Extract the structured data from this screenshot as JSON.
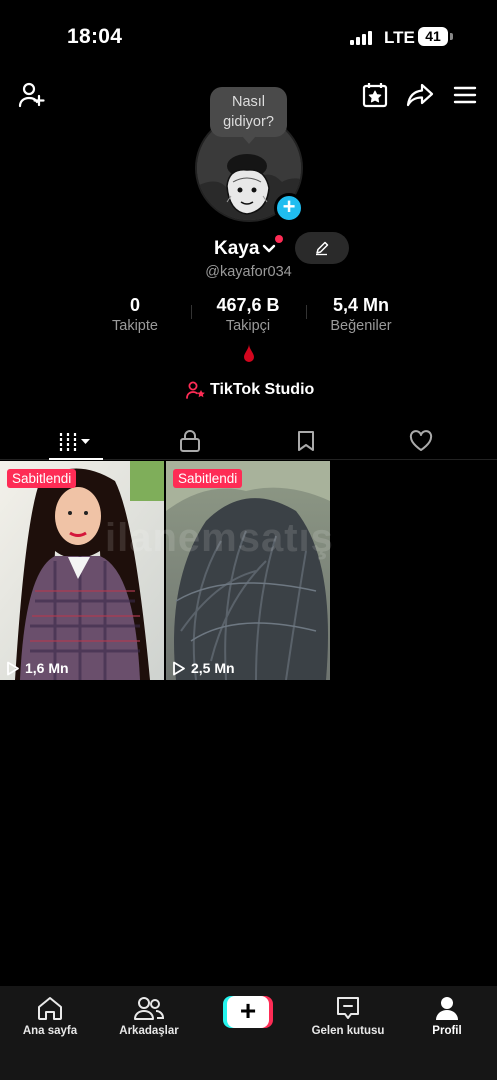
{
  "status_bar": {
    "time": "18:04",
    "network": "LTE",
    "battery": "41"
  },
  "header": {
    "left_icon": "add-friend-icon",
    "right_icons": [
      "calendar-star-icon",
      "share-icon",
      "menu-icon"
    ]
  },
  "profile": {
    "tooltip": "Nasıl gidiyor?",
    "display_name": "Kaya",
    "handle": "@kayafor034",
    "stats": [
      {
        "value": "0",
        "label": "Takipte"
      },
      {
        "value": "467,6 B",
        "label": "Takipçi"
      },
      {
        "value": "5,4 Mn",
        "label": "Beğeniler"
      }
    ],
    "studio_label": "TikTok Studio"
  },
  "tabs": [
    "videos-icon",
    "lock-icon",
    "bookmark-icon",
    "heart-icon"
  ],
  "videos": [
    {
      "badge": "Sabitlendi",
      "views": "1,6 Mn"
    },
    {
      "badge": "Sabitlendi",
      "views": "2,5 Mn"
    }
  ],
  "watermark": "ilanemsatış",
  "bottom_nav": [
    {
      "label": "Ana sayfa",
      "icon": "home-icon"
    },
    {
      "label": "Arkadaşlar",
      "icon": "friends-icon"
    },
    {
      "label": "",
      "icon": "create-icon"
    },
    {
      "label": "Gelen kutusu",
      "icon": "inbox-icon"
    },
    {
      "label": "Profil",
      "icon": "profile-icon"
    }
  ],
  "colors": {
    "accent_red": "#fe2c55",
    "accent_cyan": "#25f4ee",
    "add_blue": "#20bdf0"
  }
}
